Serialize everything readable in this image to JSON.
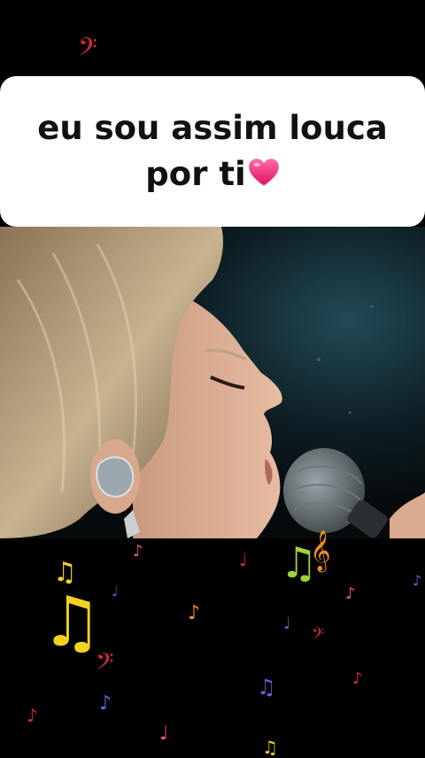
{
  "caption": {
    "line1": "eu sou assim louca",
    "line2": "por ti",
    "emoji_name": "pink-heart-emoji"
  },
  "video": {
    "subject": "singer-at-microphone",
    "background_color": "#0b1a20"
  },
  "decorations": {
    "note_glyph": "♫",
    "clef_glyph": "𝄢",
    "colors": {
      "yellow": "#f2d31b",
      "red": "#d0273a",
      "green": "#9ed236",
      "orange": "#f08a24",
      "purple": "#7a53c9",
      "pink": "#e84b8a",
      "blue": "#4a6fd6"
    }
  }
}
